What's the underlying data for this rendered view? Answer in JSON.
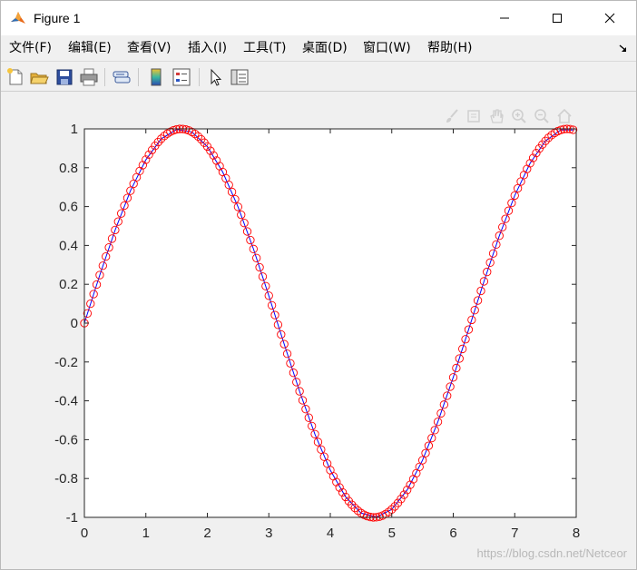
{
  "window": {
    "title": "Figure 1",
    "controls": {
      "minimize": "minimize-icon",
      "maximize": "maximize-icon",
      "close": "close-icon"
    }
  },
  "menu": {
    "items": [
      "文件(F)",
      "编辑(E)",
      "查看(V)",
      "插入(I)",
      "工具(T)",
      "桌面(D)",
      "窗口(W)",
      "帮助(H)"
    ]
  },
  "toolbar": {
    "buttons": [
      "new-figure-icon",
      "open-file-icon",
      "save-icon",
      "print-icon",
      "link-plot-icon",
      "insert-colorbar-icon",
      "insert-legend-icon",
      "edit-plot-icon",
      "property-inspector-icon"
    ]
  },
  "axes_toolbar": {
    "buttons": [
      "brush-icon",
      "data-tips-icon",
      "pan-icon",
      "zoom-in-icon",
      "zoom-out-icon",
      "home-icon"
    ]
  },
  "watermark": "https://blog.csdn.net/Netceor",
  "colors": {
    "line": "#0000ff",
    "markers": "#ff0000",
    "axes": "#262626"
  },
  "chart_data": {
    "type": "line",
    "title": "",
    "xlabel": "",
    "ylabel": "",
    "xlim": [
      0,
      8
    ],
    "ylim": [
      -1,
      1
    ],
    "xticks": [
      0,
      1,
      2,
      3,
      4,
      5,
      6,
      7,
      8
    ],
    "yticks": [
      -1,
      -0.8,
      -0.6,
      -0.4,
      -0.2,
      0,
      0.2,
      0.4,
      0.6,
      0.8,
      1
    ],
    "xtick_labels": [
      "0",
      "1",
      "2",
      "3",
      "4",
      "5",
      "6",
      "7",
      "8"
    ],
    "ytick_labels": [
      "-1",
      "-0.8",
      "-0.6",
      "-0.4",
      "-0.2",
      "0",
      "0.2",
      "0.4",
      "0.6",
      "0.8",
      "1"
    ],
    "grid": false,
    "series": [
      {
        "line_style": "solid",
        "marker": "none",
        "color": "#0000ff",
        "x": [
          0,
          0.25,
          0.5,
          0.75,
          1,
          1.25,
          1.5,
          1.75,
          2,
          2.25,
          2.5,
          2.75,
          3,
          3.25,
          3.5,
          3.75,
          4,
          4.25,
          4.5,
          4.75,
          5,
          5.25,
          5.5,
          5.75,
          6,
          6.25,
          6.5,
          6.75,
          7,
          7.25,
          7.5,
          7.75,
          7.95
        ],
        "y": [
          0,
          0.247,
          0.479,
          0.682,
          0.841,
          0.949,
          0.997,
          0.984,
          0.909,
          0.778,
          0.598,
          0.382,
          0.141,
          -0.108,
          -0.351,
          -0.572,
          -0.757,
          -0.895,
          -0.978,
          -0.999,
          -0.959,
          -0.859,
          -0.706,
          -0.508,
          -0.279,
          -0.033,
          0.215,
          0.45,
          0.657,
          0.823,
          0.938,
          0.995,
          0.994
        ]
      },
      {
        "line_style": "none",
        "marker": "circle",
        "color": "#ff0000",
        "x_start": 0,
        "x_step": 0.05,
        "x_end": 7.95,
        "function": "sin(x)"
      }
    ]
  }
}
